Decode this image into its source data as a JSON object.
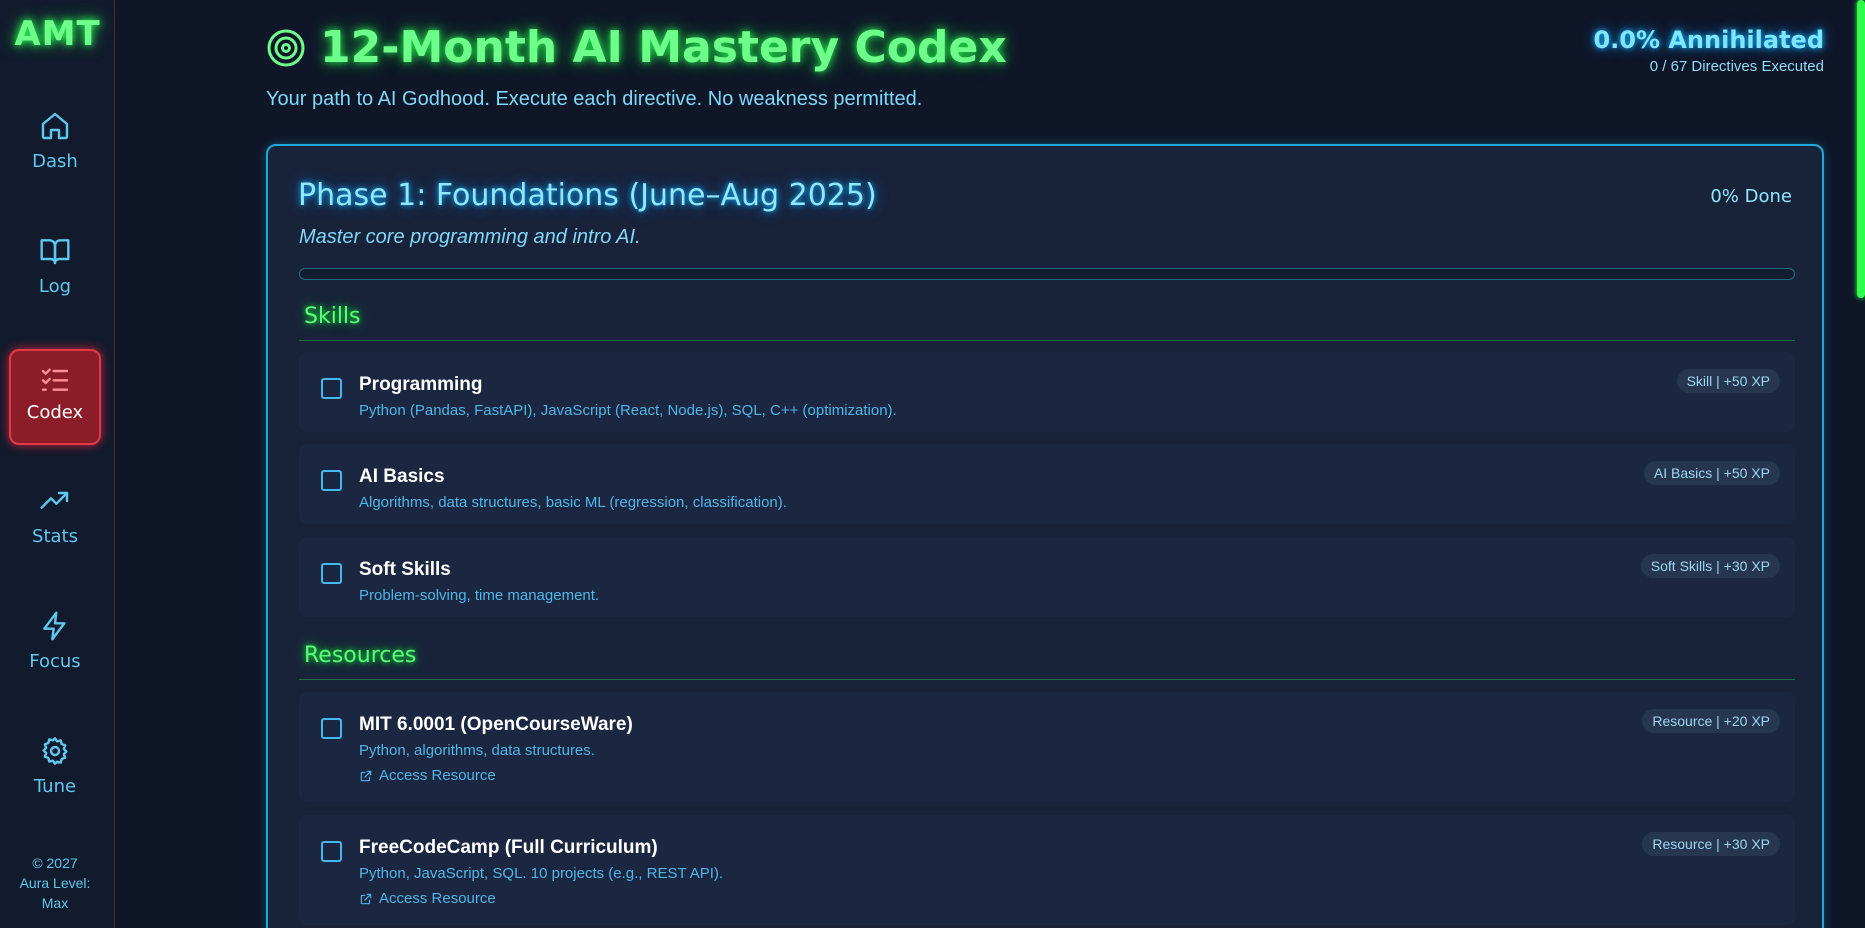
{
  "sidebar": {
    "logo": "AMT",
    "items": [
      {
        "label": "Dash",
        "icon": "home-icon"
      },
      {
        "label": "Log",
        "icon": "book-icon"
      },
      {
        "label": "Codex",
        "icon": "checklist-icon",
        "active": true
      },
      {
        "label": "Stats",
        "icon": "trending-up-icon"
      },
      {
        "label": "Focus",
        "icon": "lightning-icon"
      },
      {
        "label": "Tune",
        "icon": "gear-icon"
      }
    ],
    "footer_line1": "© 2027",
    "footer_line2": "Aura Level:",
    "footer_line3": "Max"
  },
  "header": {
    "title": "12-Month AI Mastery Codex",
    "subtitle": "Your path to AI Godhood. Execute each directive. No weakness permitted.",
    "progress_pct": "0.0% Annihilated",
    "progress_count": "0 / 67 Directives Executed"
  },
  "phase": {
    "title": "Phase 1: Foundations (June–Aug 2025)",
    "done": "0% Done",
    "progress": 0,
    "description": "Master core programming and intro AI.",
    "sections": [
      {
        "title": "Skills",
        "items": [
          {
            "name": "Programming",
            "desc": "Python (Pandas, FastAPI), JavaScript (React, Node.js), SQL, C++ (optimization).",
            "badge": "Skill | +50 XP",
            "checked": false
          },
          {
            "name": "AI Basics",
            "desc": "Algorithms, data structures, basic ML (regression, classification).",
            "badge": "AI Basics | +50 XP",
            "checked": false
          },
          {
            "name": "Soft Skills",
            "desc": "Problem-solving, time management.",
            "badge": "Soft Skills | +30 XP",
            "checked": false
          }
        ]
      },
      {
        "title": "Resources",
        "items": [
          {
            "name": "MIT 6.0001 (OpenCourseWare)",
            "desc": "Python, algorithms, data structures.",
            "link": "Access Resource",
            "badge": "Resource | +20 XP",
            "checked": false
          },
          {
            "name": "FreeCodeCamp (Full Curriculum)",
            "desc": "Python, JavaScript, SQL. 10 projects (e.g., REST API).",
            "link": "Access Resource",
            "badge": "Resource | +30 XP",
            "checked": false
          }
        ]
      }
    ]
  },
  "colors": {
    "background": "#0f1628",
    "neon_green": "#6dff8a",
    "neon_cyan": "#8fe8ff",
    "active_red": "#8c1d28"
  }
}
